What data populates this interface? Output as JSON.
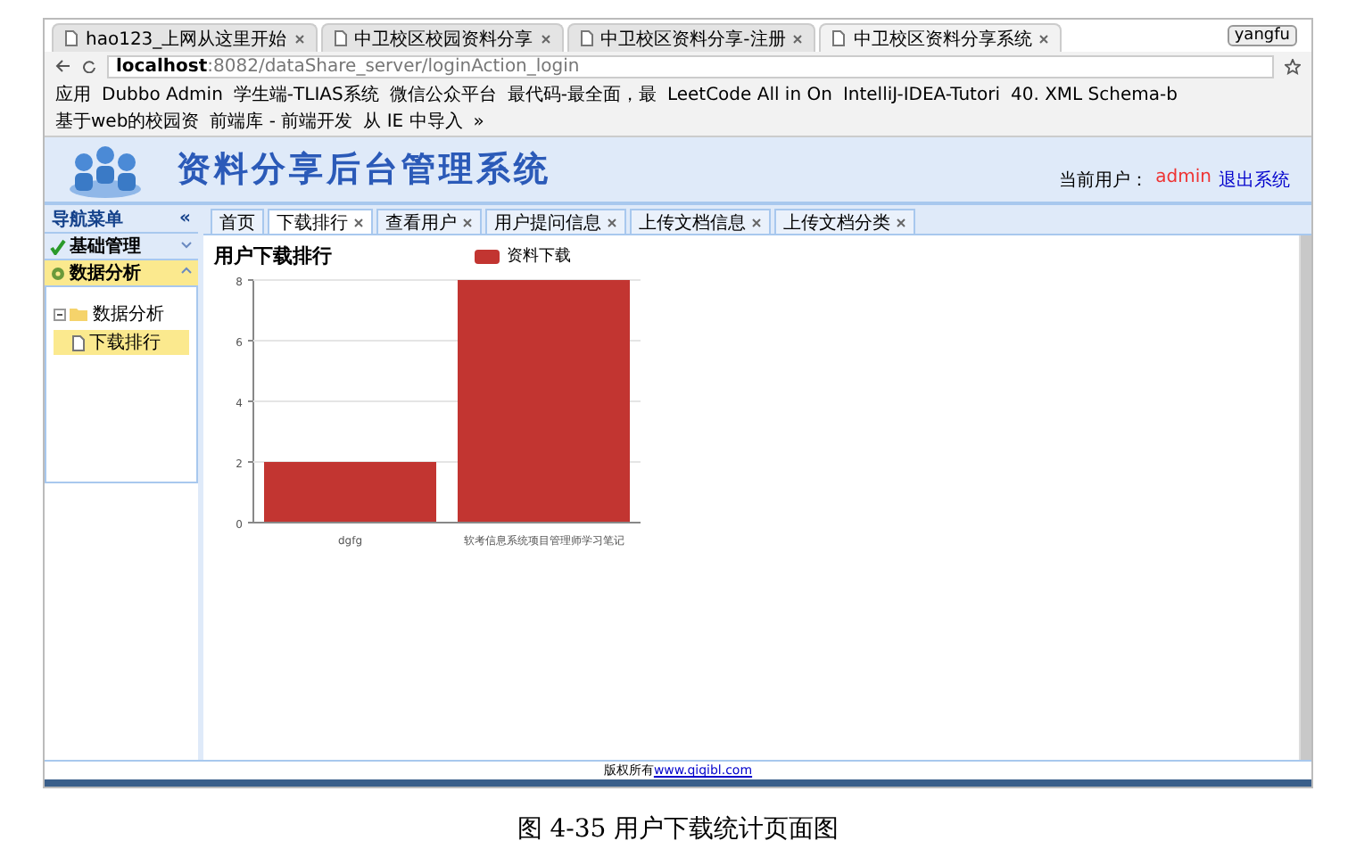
{
  "browser": {
    "tabs": [
      {
        "label": "hao123_上网从这里开始",
        "selected": false
      },
      {
        "label": "中卫校区校园资料分享",
        "selected": false
      },
      {
        "label": "中卫校区资料分享-注册",
        "selected": false
      },
      {
        "label": "中卫校区资料分享系统",
        "selected": true
      }
    ],
    "profile": "yangfu",
    "address_host": "localhost",
    "address_rest": ":8082/dataShare_server/loginAction_login",
    "bookmarks": [
      "应用",
      "Dubbo Admin",
      "学生端-TLIAS系统",
      "微信公众平台",
      "最代码-最全面，最",
      "LeetCode All in On",
      "IntelliJ-IDEA-Tutori",
      "40. XML Schema-b",
      "基于web的校园资",
      "前端库 - 前端开发",
      "从 IE 中导入",
      "»"
    ]
  },
  "app": {
    "title": "资料分享后台管理系统",
    "user_label": "当前用户：",
    "user": "admin",
    "logout": "退出系统",
    "nav": {
      "title": "导航菜单",
      "collapse": "«",
      "sections": [
        {
          "label": "基础管理",
          "expanded": false
        },
        {
          "label": "数据分析",
          "expanded": true,
          "tree": [
            {
              "label": "数据分析",
              "expanded": true,
              "children": [
                {
                  "label": "下载排行",
                  "selected": true
                }
              ]
            }
          ]
        }
      ]
    },
    "tabs": [
      {
        "label": "首页",
        "closable": false,
        "selected": false
      },
      {
        "label": "下载排行",
        "closable": true,
        "selected": true
      },
      {
        "label": "查看用户",
        "closable": true,
        "selected": false
      },
      {
        "label": "用户提问信息",
        "closable": true,
        "selected": false
      },
      {
        "label": "上传文档信息",
        "closable": true,
        "selected": false
      },
      {
        "label": "上传文档分类",
        "closable": true,
        "selected": false
      }
    ],
    "chart_title": "用户下载排行",
    "chart_data": {
      "type": "bar",
      "categories": [
        "dgfg",
        "软考信息系统项目管理师学习笔记"
      ],
      "series": [
        {
          "name": "资料下载",
          "color": "#c23531",
          "values": [
            2,
            8
          ]
        }
      ],
      "ylim": [
        0,
        8
      ],
      "grid": true,
      "yticks": [
        0,
        2,
        4,
        6,
        8
      ]
    },
    "footer_text": "版权所有",
    "footer_link": "www.qiqibl.com"
  },
  "caption": "图 4-35 用户下载统计页面图"
}
